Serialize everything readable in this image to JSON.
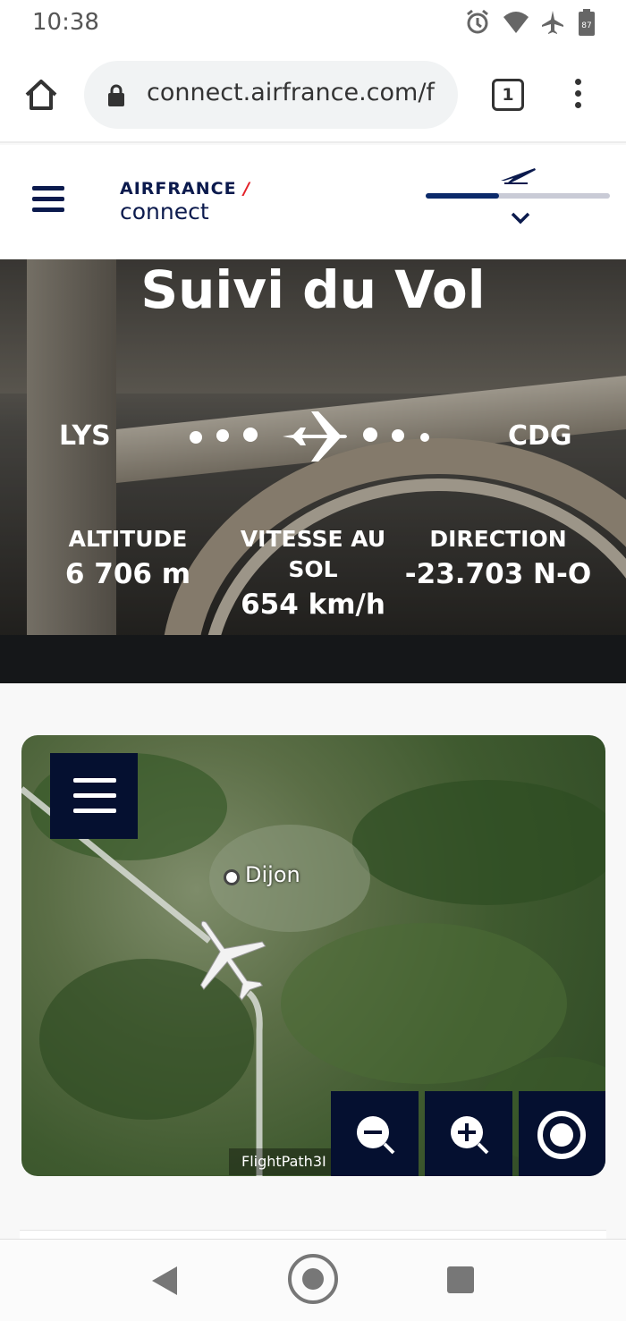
{
  "status_bar": {
    "time": "10:38",
    "icons": [
      "alarm-icon",
      "wifi-icon",
      "airplane-mode-icon",
      "battery-icon"
    ],
    "battery_level": "87"
  },
  "browser": {
    "url": "connect.airfrance.com/f",
    "tab_count": "1",
    "icons": [
      "home-icon",
      "lock-icon",
      "tabs-icon",
      "more-options-icon"
    ]
  },
  "header": {
    "logo_top": "AIRFRANCE",
    "logo_bottom": "connect",
    "flight_progress": 0.4,
    "colors": {
      "brand_navy": "#0b1a4d",
      "brand_red": "#e32028"
    }
  },
  "hero": {
    "title": "Suivi du Vol",
    "origin": "LYS",
    "destination": "CDG",
    "stats": [
      {
        "label": "ALTITUDE",
        "value": "6 706 m"
      },
      {
        "label": "VITESSE AU SOL",
        "value": "654 km/h"
      },
      {
        "label": "DIRECTION",
        "value": "-23.703 N-O"
      }
    ]
  },
  "map": {
    "city_label": "Dijon",
    "attribution": "FlightPath3I",
    "controls": [
      "zoom-out-icon",
      "zoom-in-icon",
      "recenter-icon"
    ]
  },
  "nav": {
    "icons": [
      "back-icon",
      "home-icon",
      "recents-icon"
    ]
  }
}
